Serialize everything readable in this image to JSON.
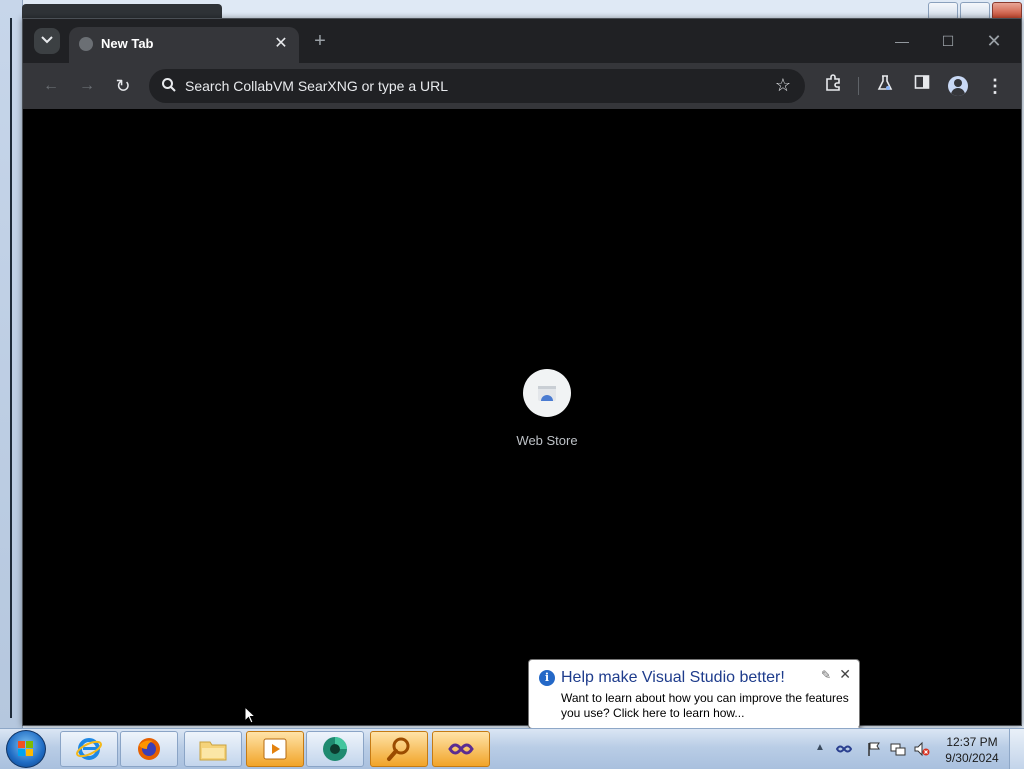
{
  "browser": {
    "tab": {
      "title": "New Tab",
      "close_glyph": "✕"
    },
    "new_tab_glyph": "+",
    "window_controls": {
      "minimize": "—",
      "maximize": "☐",
      "close": "✕"
    },
    "toolbar": {
      "back_glyph": "←",
      "forward_glyph": "→",
      "reload_glyph": "↻",
      "omnibox_placeholder": "Search CollabVM SearXNG or type a URL",
      "bookmark_glyph": "☆",
      "extensions_icon": "puzzle-icon",
      "labs_icon": "flask-icon",
      "side_panel_icon": "side-panel-icon",
      "profile_icon": "profile-icon",
      "menu_glyph": "⋮"
    },
    "shortcuts": [
      {
        "label": "Web Store",
        "icon": "web-store-icon"
      }
    ]
  },
  "notification": {
    "title": "Help make Visual Studio better!",
    "text": "Want to learn about how you can improve the features you use? Click here to learn how...",
    "icon": "info-icon",
    "close_glyph": "✕",
    "options_glyph": "✎"
  },
  "taskbar": {
    "start_icon": "windows-start-icon",
    "apps": [
      {
        "name": "internet-explorer",
        "icon": "ie-icon",
        "active": false
      },
      {
        "name": "firefox",
        "icon": "firefox-icon",
        "active": false
      },
      {
        "name": "file-explorer",
        "icon": "folder-icon",
        "active": false
      },
      {
        "name": "media-player",
        "icon": "media-player-icon",
        "active": true
      },
      {
        "name": "chrome-variant",
        "icon": "green-browser-icon",
        "active": false
      },
      {
        "name": "search-app",
        "icon": "magnifier-icon",
        "active": true
      },
      {
        "name": "visual-studio",
        "icon": "visual-studio-icon",
        "active": true
      }
    ],
    "tray": {
      "show_hidden_glyph": "▲",
      "time": "12:37 PM",
      "date": "9/30/2024"
    }
  },
  "colors": {
    "titlebar": "#202124",
    "toolbar": "#35363a",
    "content": "#000000",
    "balloon_title": "#1e3c8c"
  }
}
